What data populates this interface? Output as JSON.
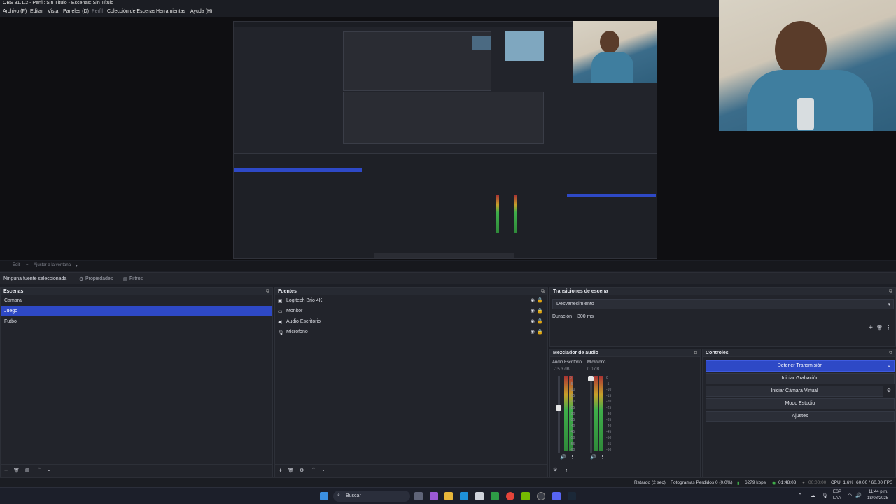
{
  "window": {
    "title": "OBS 31.1.2 - Perfil: Sin Título - Escenas: Sin Título"
  },
  "menu": [
    "Archivo (F)",
    "Editar",
    "Vista",
    "Paneles (D)",
    "Perfil",
    "Colección de Escenas",
    "Herramientas",
    "Ayuda (H)"
  ],
  "scalebar": {
    "mode": "Edit",
    "fit": "Ajustar a la ventana"
  },
  "source_toolbar": {
    "none_selected": "Ninguna fuente seleccionada",
    "properties": "Propiedades",
    "filters": "Filtros"
  },
  "scenes": {
    "title": "Escenas",
    "items": [
      "Camara",
      "Juego",
      "Futbol"
    ],
    "selected": 1
  },
  "sources": {
    "title": "Fuentes",
    "items": [
      {
        "name": "Logitech Brio 4K",
        "icon": "camera-icon"
      },
      {
        "name": "Monitor",
        "icon": "monitor-icon"
      },
      {
        "name": "Audio Escritorio",
        "icon": "speaker-icon"
      },
      {
        "name": "Microfono",
        "icon": "microphone-icon"
      }
    ]
  },
  "transitions": {
    "title": "Transiciones de escena",
    "selected": "Desvanecimiento",
    "duration_label": "Duración",
    "duration_value": "300 ms"
  },
  "mixer": {
    "title": "Mezclador de audio",
    "channels": [
      {
        "name": "Audio Escritorio",
        "db": "-15.3 dB"
      },
      {
        "name": "Microfono",
        "db": "0.0 dB"
      }
    ],
    "scale": [
      "0",
      "-5",
      "-10",
      "-15",
      "-20",
      "-25",
      "-30",
      "-35",
      "-40",
      "-45",
      "-50",
      "-55",
      "-60"
    ]
  },
  "controls": {
    "title": "Controles",
    "stop_stream": "Detener Transmisión",
    "start_recording": "Iniciar Grabación",
    "start_virtual_cam": "Iniciar Cámara Virtual",
    "studio_mode": "Modo Estudio",
    "settings": "Ajustes"
  },
  "status": {
    "delay": "Retardo (2 sec)",
    "dropped": "Fotogramas Perdidos 0 (0.0%)",
    "bitrate": "6279 kbps",
    "stream_time": "01:48:03",
    "rec_time": "00:00:00",
    "cpu": "CPU: 1.6%",
    "fps": "60.00 / 60.00 FPS"
  },
  "taskbar": {
    "search": "Buscar",
    "lang": "ESP",
    "lang2": "LAA",
    "time": "11:44 p.m.",
    "date": "18/08/2025"
  },
  "colors": {
    "accent": "#2e49c6",
    "background": "#1d1f26",
    "dock": "#22242b"
  }
}
